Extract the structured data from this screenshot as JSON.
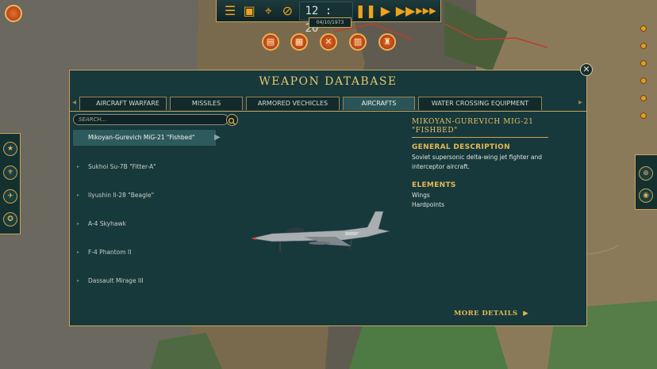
{
  "topbar": {
    "time": "12 : 20",
    "date": "04/10/1973",
    "icons": [
      "menu-icon",
      "report-icon",
      "location-pin-icon",
      "no-supply-icon",
      "pause-icon",
      "play-icon",
      "fast-forward-icon",
      "fastest-forward-icon"
    ]
  },
  "quick_buttons": [
    "orders-icon",
    "intel-icon",
    "cancel-icon",
    "library-icon",
    "commander-icon"
  ],
  "left_sidebar": [
    "rank-icon",
    "faction-emblem-icon",
    "aircraft-icon",
    "medal-icon"
  ],
  "dialog": {
    "title": "WEAPON DATABASE",
    "tabs": [
      {
        "label": "AIRCRAFT WARFARE",
        "active": false
      },
      {
        "label": "MISSILES",
        "active": false
      },
      {
        "label": "ARMORED VECHICLES",
        "active": false
      },
      {
        "label": "AIRCRAFTS",
        "active": true
      },
      {
        "label": "WATER CROSSING EQUIPMENT",
        "active": false
      }
    ],
    "search": {
      "placeholder": "SEARCH...",
      "value": ""
    },
    "list": [
      "Mikoyan-Gurevich MiG-21 \"Fishbed\"",
      "Sukhoi Su-7B \"Fitter-A\"",
      "Ilyushin Il-28 \"Beagle\"",
      "A-4 Skyhawk",
      "F-4 Phantom II",
      "Dassault Mirage III"
    ],
    "selected_index": 0,
    "detail": {
      "name": "MIKOYAN-GUREVICH MIG-21 \"FISHBED\"",
      "general_heading": "GENERAL DESCRIPTION",
      "general_text": "Soviet supersonic delta-wing jet fighter and interceptor aircraft.",
      "elements_heading": "ELEMENTS",
      "elements": [
        "Wings",
        "Hardpoints"
      ],
      "more_details": "MORE DETAILS"
    }
  },
  "colors": {
    "accent_gold": "#c9a35a",
    "panel": "#17393c",
    "title_gold": "#e8c46c",
    "orange_button": "#e26a2c"
  }
}
